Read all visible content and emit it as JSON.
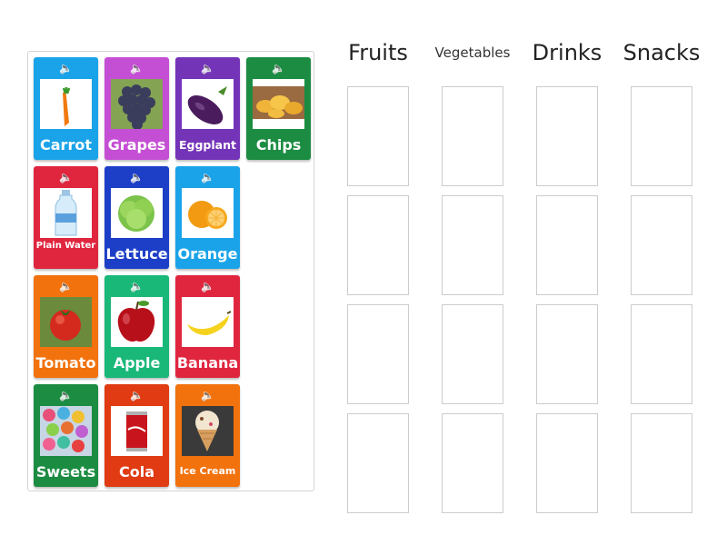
{
  "cards": [
    {
      "label": "Carrot",
      "icon": "carrot-icon",
      "color": "#1aa3e8"
    },
    {
      "label": "Grapes",
      "icon": "grapes-icon",
      "color": "#c54fd4"
    },
    {
      "label": "Eggplant",
      "icon": "eggplant-icon",
      "color": "#7434b8"
    },
    {
      "label": "Chips",
      "icon": "chips-icon",
      "color": "#1c8c42"
    },
    {
      "label": "Plain Water",
      "icon": "water-bottle-icon",
      "color": "#e0263f"
    },
    {
      "label": "Lettuce",
      "icon": "lettuce-icon",
      "color": "#1d3fc7"
    },
    {
      "label": "Orange",
      "icon": "orange-icon",
      "color": "#1aa3e8"
    },
    {
      "label": "Tomato",
      "icon": "tomato-icon",
      "color": "#f2720d"
    },
    {
      "label": "Apple",
      "icon": "apple-icon",
      "color": "#19b879"
    },
    {
      "label": "Banana",
      "icon": "banana-icon",
      "color": "#e0263f"
    },
    {
      "label": "Sweets",
      "icon": "sweets-icon",
      "color": "#1c8c42"
    },
    {
      "label": "Cola",
      "icon": "cola-can-icon",
      "color": "#e03b12"
    },
    {
      "label": "Ice Cream",
      "icon": "ice-cream-icon",
      "color": "#f2720d"
    }
  ],
  "speaker_icon": "speaker-icon",
  "categories": [
    "Fruits",
    "Vegetables",
    "Drinks",
    "Snacks"
  ],
  "slots_per_category": 4
}
